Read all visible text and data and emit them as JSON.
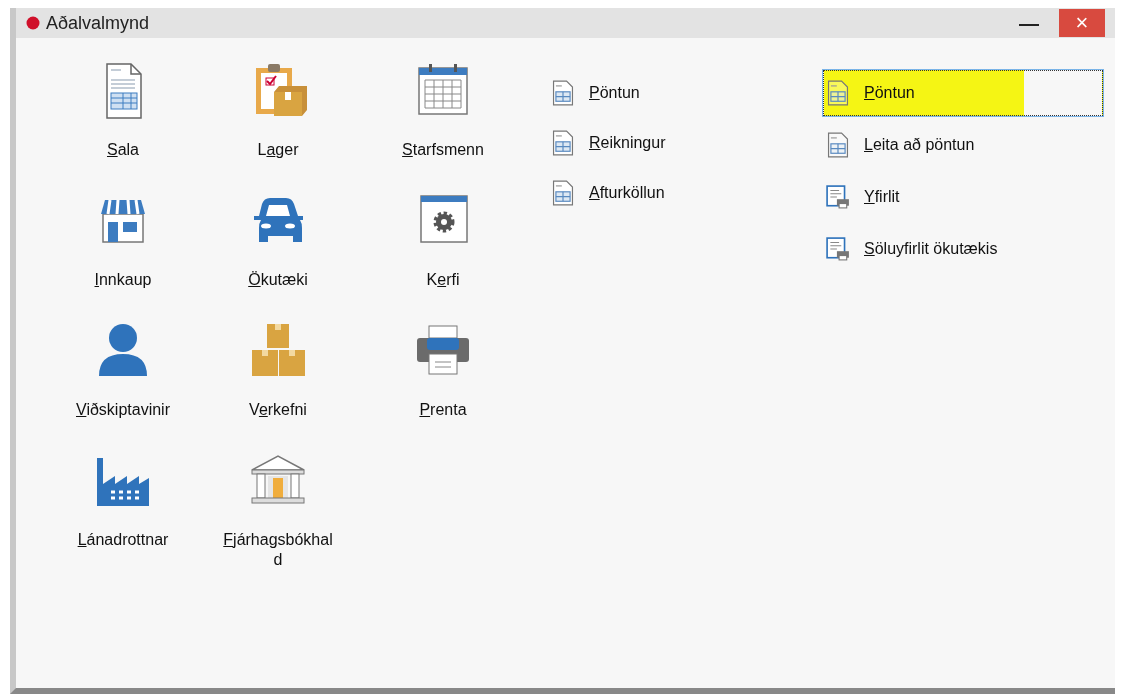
{
  "window": {
    "title": "Aðalvalmynd",
    "minimize": "—",
    "close": "×"
  },
  "modules": [
    {
      "kind": "sales",
      "label": {
        "key": "S",
        "rest": "ala"
      }
    },
    {
      "kind": "stock",
      "label": {
        "lead": "L",
        "key": "a",
        "rest": "ger"
      }
    },
    {
      "kind": "staff",
      "label": {
        "key": "S",
        "rest": "tarfsmenn"
      }
    },
    {
      "kind": "purchase",
      "label": {
        "key": "I",
        "rest": "nnkaup"
      }
    },
    {
      "kind": "vehicle",
      "label": {
        "key": "Ö",
        "rest": "kutæki"
      }
    },
    {
      "kind": "system",
      "label": {
        "lead": "K",
        "key": "e",
        "rest": "rfi"
      }
    },
    {
      "kind": "customer",
      "label": {
        "key": "V",
        "rest": "iðskiptavinir"
      }
    },
    {
      "kind": "project",
      "label": {
        "lead": "V",
        "key": "e",
        "rest": "rkefni"
      }
    },
    {
      "kind": "print",
      "label": {
        "key": "P",
        "rest": "renta"
      }
    },
    {
      "kind": "creditor",
      "label": {
        "key": "L",
        "rest": "ánadrottnar"
      }
    },
    {
      "kind": "ledger",
      "label": {
        "key": "F",
        "rest": "járhagsbókhald"
      }
    }
  ],
  "actions": [
    {
      "kind": "document",
      "label": {
        "key": "P",
        "rest": "öntun"
      }
    },
    {
      "kind": "document",
      "label": {
        "key": "R",
        "rest": "eikningur"
      }
    },
    {
      "kind": "document",
      "label": {
        "key": "A",
        "rest": "fturköllun"
      }
    }
  ],
  "sub_actions": [
    {
      "kind": "document",
      "selected": true,
      "label": {
        "key": "P",
        "rest": "öntun"
      }
    },
    {
      "kind": "document",
      "selected": false,
      "label": {
        "key": "L",
        "rest": "eita að pöntun"
      }
    },
    {
      "kind": "report",
      "selected": false,
      "label": {
        "key": "Y",
        "rest": "firlit"
      }
    },
    {
      "kind": "report",
      "selected": false,
      "label": {
        "key": "S",
        "rest": "öluyfirlit ökutækis"
      }
    }
  ]
}
